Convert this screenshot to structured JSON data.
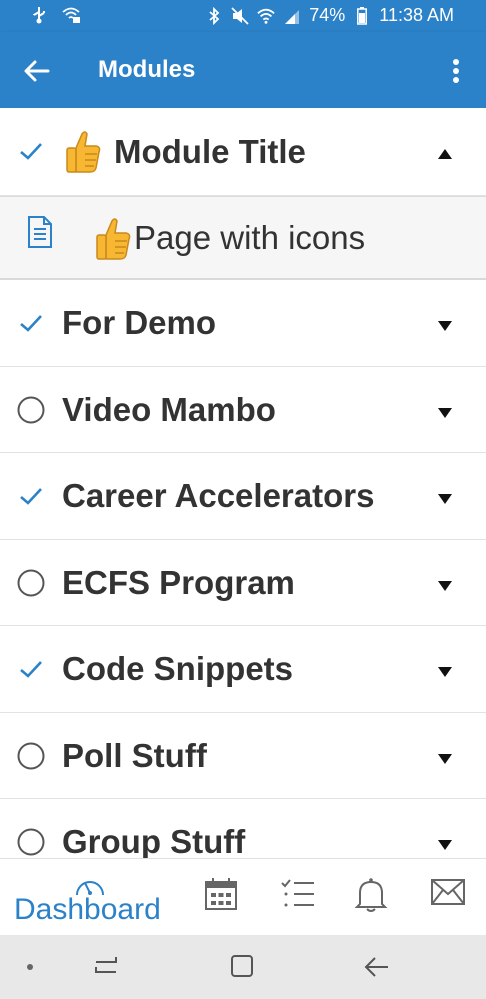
{
  "status_bar": {
    "battery": "74%",
    "time": "11:38 AM"
  },
  "app_bar": {
    "title": "Modules"
  },
  "modules": [
    {
      "name": "Module Title",
      "completed": true,
      "expanded": true,
      "has_thumb_icon": true
    },
    {
      "name": "For Demo",
      "completed": true,
      "expanded": false
    },
    {
      "name": "Video Mambo",
      "completed": false,
      "expanded": false
    },
    {
      "name": "Career Accelerators",
      "completed": true,
      "expanded": false
    },
    {
      "name": "ECFS Program",
      "completed": false,
      "expanded": false
    },
    {
      "name": "Code Snippets",
      "completed": true,
      "expanded": false
    },
    {
      "name": "Poll Stuff",
      "completed": false,
      "expanded": false
    },
    {
      "name": "Group Stuff",
      "completed": false,
      "expanded": false
    }
  ],
  "expanded_item": {
    "label": "Page with icons",
    "type_icon": "page-icon",
    "has_thumb_icon": true
  },
  "bottom_nav": {
    "dashboard_label": "Dashboard",
    "items": [
      "dashboard-icon",
      "calendar-icon",
      "todo-list-icon",
      "bell-icon",
      "mail-icon"
    ]
  },
  "colors": {
    "primary": "#2b82c9",
    "text": "#333333",
    "check": "#2b82c9"
  }
}
